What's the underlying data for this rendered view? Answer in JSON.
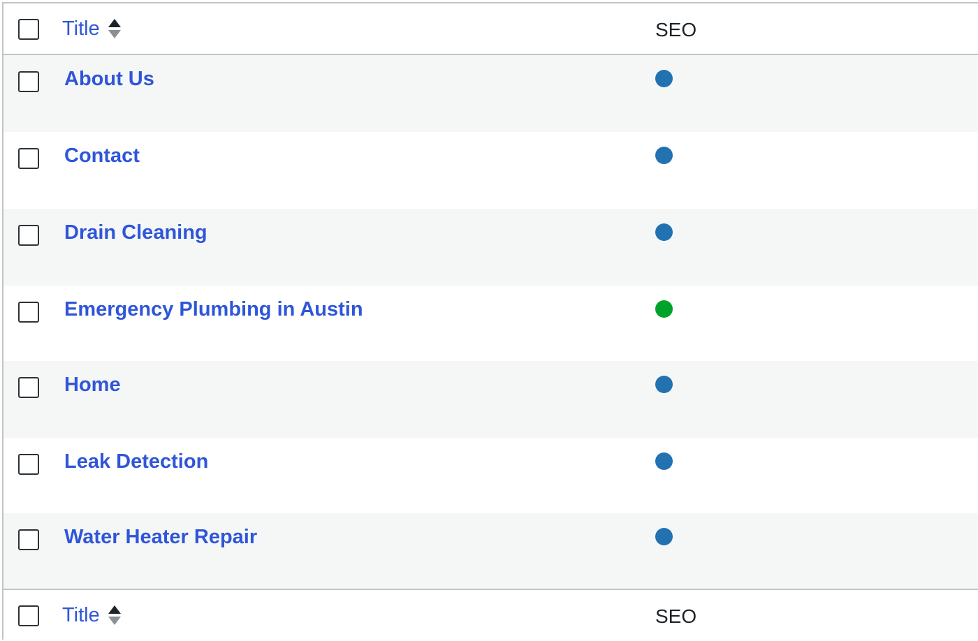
{
  "columns": {
    "title_label": "Title",
    "seo_label": "SEO"
  },
  "icons": {
    "sort": "sort-up-down-icon",
    "status_dot": "seo-status-dot-icon"
  },
  "colors": {
    "link": "#2f56d8",
    "seo_default": "#2271b1",
    "seo_good": "#00a32a",
    "row_alt": "#f5f7f6"
  },
  "rows": [
    {
      "title": "About Us",
      "seo_status": "default"
    },
    {
      "title": "Contact",
      "seo_status": "default"
    },
    {
      "title": "Drain Cleaning",
      "seo_status": "default"
    },
    {
      "title": "Emergency Plumbing in Austin",
      "seo_status": "good"
    },
    {
      "title": "Home",
      "seo_status": "default"
    },
    {
      "title": "Leak Detection",
      "seo_status": "default"
    },
    {
      "title": "Water Heater Repair",
      "seo_status": "default"
    }
  ]
}
